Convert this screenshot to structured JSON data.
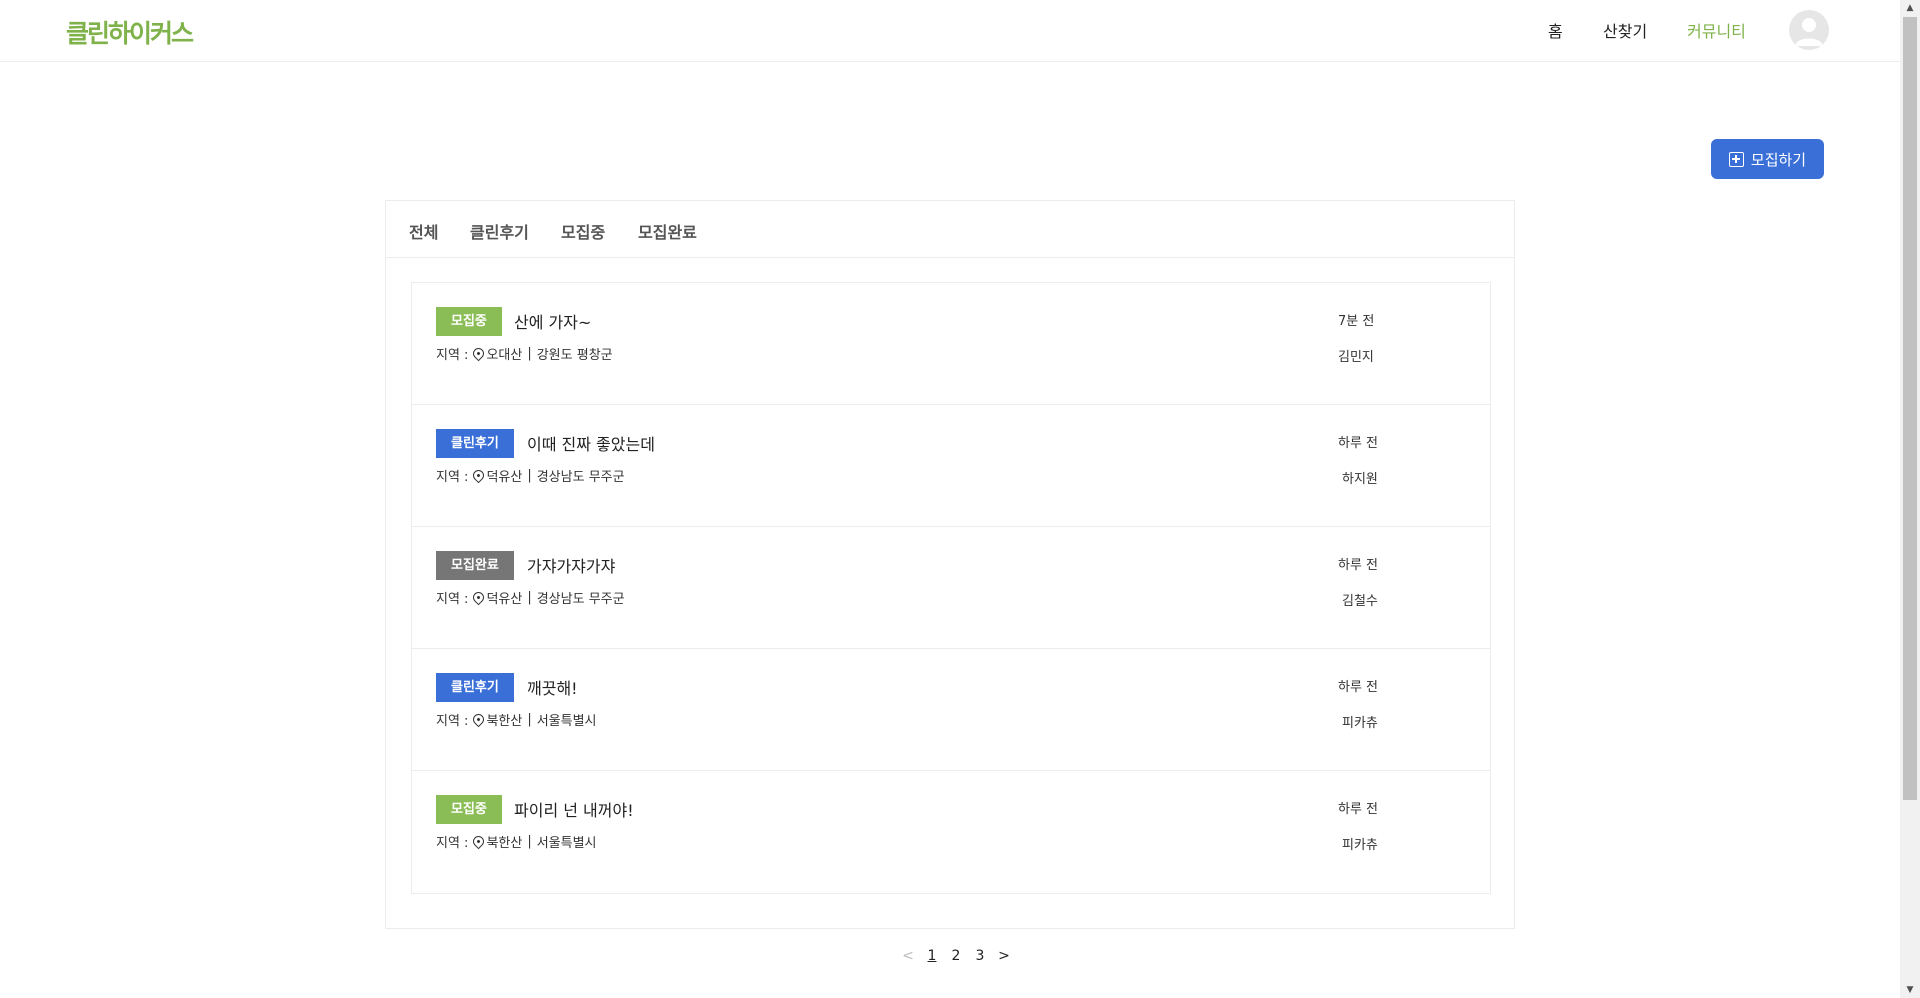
{
  "header": {
    "logo": "클린하이커스",
    "nav": {
      "home": "홈",
      "mountain": "산찾기",
      "community": "커뮤니티"
    }
  },
  "recruit_button": "모집하기",
  "tabs": [
    "전체",
    "클린후기",
    "모집중",
    "모집완료"
  ],
  "region_label": "지역 :",
  "posts": [
    {
      "badge": "모집중",
      "badge_type": "recruit",
      "title": "산에 가자~",
      "mountain": "오대산",
      "location": "강원도 평창군",
      "time": "7분 전",
      "author": "김민지"
    },
    {
      "badge": "클린후기",
      "badge_type": "review",
      "title": "이때 진짜 좋았는데",
      "mountain": "덕유산",
      "location": "경상남도 무주군",
      "time": "하루 전",
      "author": "하지원"
    },
    {
      "badge": "모집완료",
      "badge_type": "done",
      "title": "가쟈가쟈가쟈",
      "mountain": "덕유산",
      "location": "경상남도 무주군",
      "time": "하루 전",
      "author": "김철수"
    },
    {
      "badge": "클린후기",
      "badge_type": "review",
      "title": "깨끗해!",
      "mountain": "북한산",
      "location": "서울특별시",
      "time": "하루 전",
      "author": "피카츄"
    },
    {
      "badge": "모집중",
      "badge_type": "recruit",
      "title": "파이리 넌 내꺼야!",
      "mountain": "북한산",
      "location": "서울특별시",
      "time": "하루 전",
      "author": "피카츄"
    }
  ],
  "pagination": {
    "prev": "<",
    "pages": [
      "1",
      "2",
      "3"
    ],
    "current": "1",
    "next": ">"
  },
  "colors": {
    "brand_green": "#7fb24a",
    "recruit_badge": "#8bbd56",
    "review_badge": "#3a6fd8",
    "done_badge": "#767676",
    "primary_button": "#3a6fd8"
  }
}
